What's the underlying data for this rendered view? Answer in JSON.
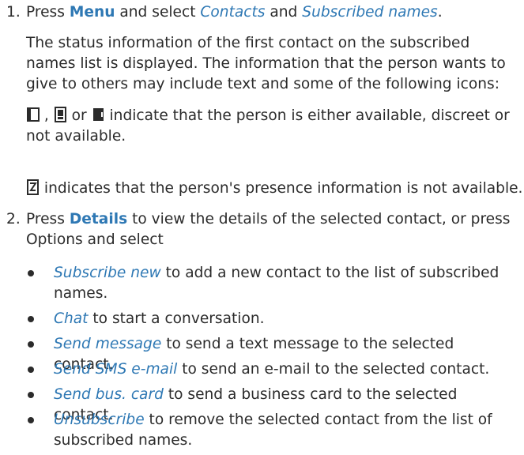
{
  "steps": [
    {
      "number": "1.",
      "intro": "Press ",
      "menu_kw": "Menu",
      "and_select": " and select ",
      "item1": "Contacts",
      "and": " and ",
      "item2": "Subscribed names",
      "end": ".",
      "para1": "The status information of the first contact on the subscribed names list is displayed. The information that the person wants to give to others may include text and some of the following icons:",
      "icons_sep1": " , ",
      "icons_or": " or ",
      "para2_text": " indicate that the person is either available, discreet or not available.",
      "para3_text": " indicates that the person's presence information is not available."
    },
    {
      "number": "2.",
      "intro": "Press ",
      "details_kw": "Details",
      "rest": " to view the details of the selected contact, or press Options and select"
    }
  ],
  "bullets": [
    {
      "term": "Subscribe new",
      "desc": " to add a new contact to the list of subscribed names."
    },
    {
      "term": "Chat",
      "desc": " to start a conversation."
    },
    {
      "term": "Send message",
      "desc": " to send a text message to the selected contact."
    },
    {
      "term": "Send SMS e-mail",
      "desc": " to send an e-mail to the selected contact."
    },
    {
      "term": "Send bus. card",
      "desc": " to send a business card to the selected contact."
    },
    {
      "term": "Unsubscribe",
      "desc": " to remove the selected contact from the list of subscribed names."
    }
  ],
  "colors": {
    "link": "#2e78b4",
    "text": "#2b2b2b"
  },
  "icons": [
    "status-available-icon",
    "status-discreet-icon",
    "status-not-available-icon",
    "presence-unavailable-icon"
  ]
}
